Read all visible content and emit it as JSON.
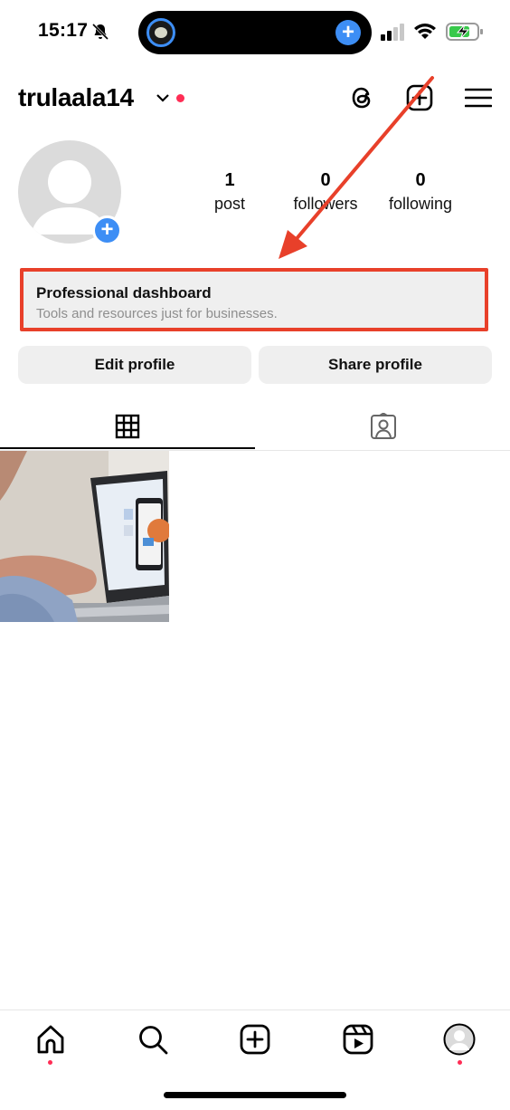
{
  "status_bar": {
    "time": "15:17",
    "icons": [
      "bell-muted-icon",
      "signal-icon",
      "wifi-icon",
      "battery-charging-icon"
    ],
    "island_icons": [
      "live-activity-icon",
      "plus-icon"
    ]
  },
  "header": {
    "username": "trulaala14",
    "icons": [
      "chevron-down-icon",
      "threads-icon",
      "create-post-icon",
      "menu-icon"
    ]
  },
  "profile": {
    "stats": [
      {
        "value": "1",
        "label": "post"
      },
      {
        "value": "0",
        "label": "followers"
      },
      {
        "value": "0",
        "label": "following"
      }
    ]
  },
  "pro_dashboard": {
    "title": "Professional dashboard",
    "subtitle": "Tools and resources just for businesses."
  },
  "buttons": {
    "edit": "Edit profile",
    "share": "Share profile"
  },
  "tabs": [
    "grid-icon",
    "tagged-icon"
  ],
  "bottom_nav": [
    "home-icon",
    "search-icon",
    "create-icon",
    "reels-icon",
    "profile-avatar-icon"
  ],
  "colors": {
    "accent": "#3d8ef5",
    "highlight": "#e8402a",
    "notification": "#ff2d55",
    "button_bg": "#efefef"
  }
}
